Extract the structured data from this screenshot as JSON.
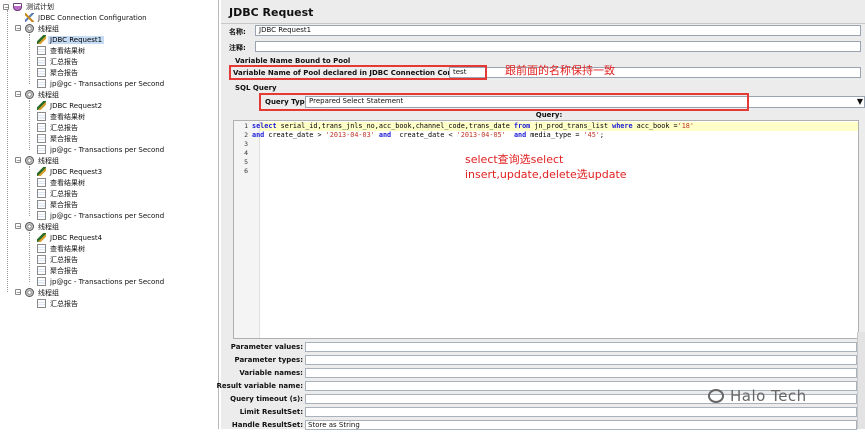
{
  "tree": {
    "root": "测试计划",
    "connection_config": "JDBC Connection Configuration",
    "groups": [
      {
        "label": "线程组",
        "request": "JDBC Request1",
        "listeners": [
          "查看结果树",
          "汇总报告",
          "聚合报告",
          "jp@gc - Transactions per Second"
        ]
      },
      {
        "label": "线程组",
        "request": "JDBC Request2",
        "listeners": [
          "查看结果树",
          "汇总报告",
          "聚合报告",
          "jp@gc - Transactions per Second"
        ]
      },
      {
        "label": "线程组",
        "request": "JDBC Request3",
        "listeners": [
          "查看结果树",
          "汇总报告",
          "聚合报告",
          "jp@gc - Transactions per Second"
        ]
      },
      {
        "label": "线程组",
        "request": "JDBC Request4",
        "listeners": [
          "查看结果树",
          "汇总报告",
          "聚合报告",
          "jp@gc - Transactions per Second"
        ]
      }
    ],
    "last_group": {
      "label": "线程组",
      "listener": "汇总报告"
    }
  },
  "panel": {
    "title": "JDBC Request",
    "name_label": "名称:",
    "name_value": "JDBC Request1",
    "comment_label": "注释:",
    "comment_value": "",
    "pool_section": "Variable Name Bound to Pool",
    "pool_label": "Variable Name of Pool declared in JDBC Connection Configuration:",
    "pool_value": "test",
    "sql_section": "SQL Query",
    "query_type_label": "Query Type:",
    "query_type_value": "Prepared Select Statement",
    "query_header": "Query:",
    "line_numbers": [
      "1",
      "2",
      "3",
      "4",
      "5",
      "6"
    ]
  },
  "params": [
    {
      "label": "Parameter values:",
      "value": ""
    },
    {
      "label": "Parameter types:",
      "value": ""
    },
    {
      "label": "Variable names:",
      "value": ""
    },
    {
      "label": "Result variable name:",
      "value": ""
    },
    {
      "label": "Query timeout (s):",
      "value": ""
    },
    {
      "label": "Limit ResultSet:",
      "value": ""
    },
    {
      "label": "Handle ResultSet:",
      "value": "Store as String"
    }
  ],
  "annotations": {
    "pool_note": "跟前面的名称保持一致",
    "query_note_1": "select查询选select",
    "query_note_2": "insert,update,delete选update"
  },
  "watermark": "Halo Tech",
  "colors": {
    "annotation": "#e53935",
    "selection": "#c6dcf5",
    "keyword": "#1c1cd6",
    "string": "#c0392b",
    "panel_bg": "#ececec"
  }
}
